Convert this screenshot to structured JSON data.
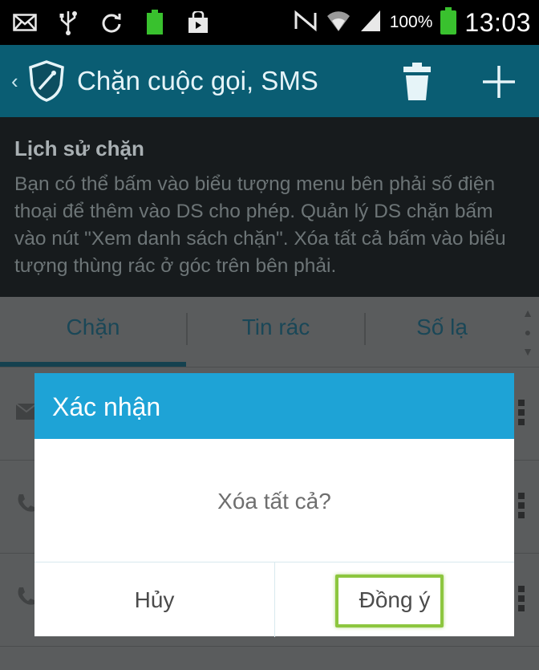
{
  "status_bar": {
    "left_icons": [
      "mail-icon",
      "usb-icon",
      "sync-icon",
      "battery-charging-icon",
      "store-icon"
    ],
    "right_icons": [
      "nfc-icon",
      "wifi-icon",
      "signal-icon"
    ],
    "battery_percent": "100%",
    "time": "13:03",
    "battery_color": "#39c12e"
  },
  "app_bar": {
    "title": "Chặn cuộc gọi, SMS",
    "back_icon": "chevron-left-icon",
    "logo_icon": "shield-icon",
    "delete_icon": "trash-icon",
    "add_icon": "plus-icon",
    "color": "#0a5d73"
  },
  "info": {
    "heading": "Lịch sử chặn",
    "description": "Bạn có thể bấm vào biểu tượng menu bên phải số điện thoại để thêm vào DS cho phép. Quản lý DS chặn bấm vào nút \"Xem danh sách chặn\". Xóa tất cả bấm vào biểu tượng thùng rác ở góc trên bên phải."
  },
  "tabs": [
    {
      "label": "Chặn",
      "selected": true
    },
    {
      "label": "Tin rác",
      "selected": false
    },
    {
      "label": "Số lạ",
      "selected": false
    }
  ],
  "list_rows": [
    {
      "icon": "envelope-icon"
    },
    {
      "icon": "phone-icon"
    },
    {
      "icon": "phone-icon"
    }
  ],
  "dialog": {
    "title": "Xác nhận",
    "message": "Xóa tất cả?",
    "cancel_label": "Hủy",
    "ok_label": "Đồng ý",
    "header_color": "#1ea3d6",
    "highlight_color": "#8dc63f"
  }
}
